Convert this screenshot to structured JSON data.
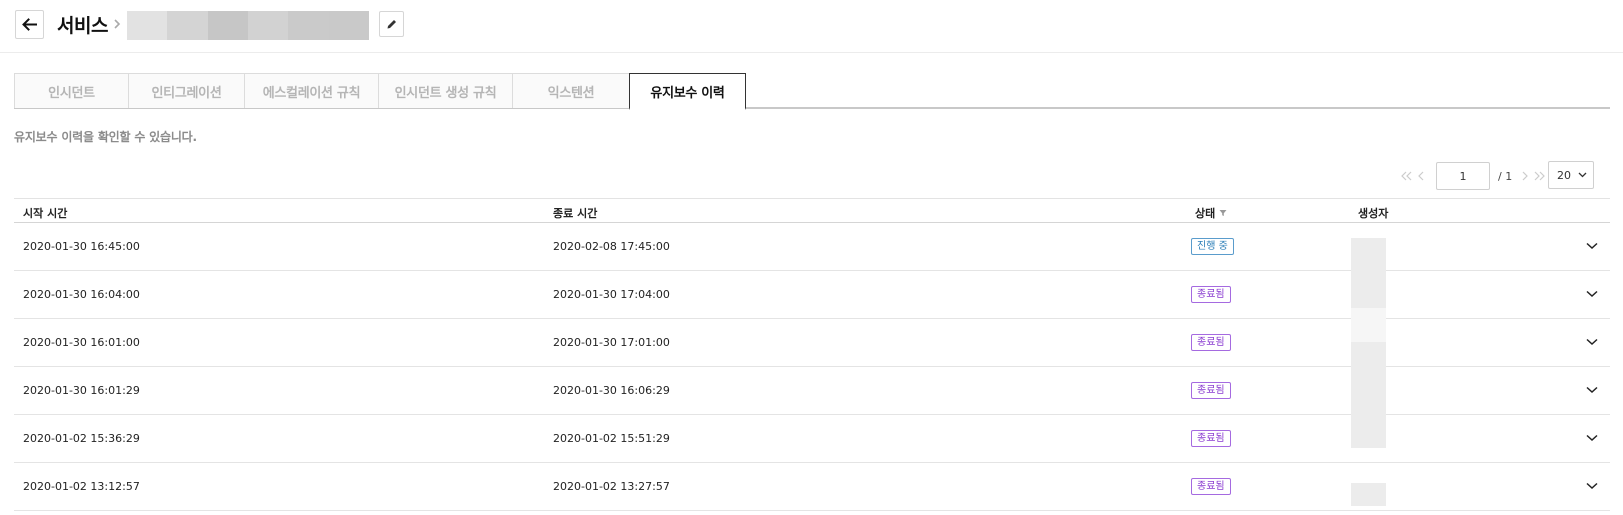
{
  "header": {
    "back_icon": "arrow-left-icon",
    "title": "서비스",
    "separator_icon": "chevron-right-icon",
    "edit_icon": "pencil-icon"
  },
  "tabs": [
    {
      "label": "인시던트",
      "active": false
    },
    {
      "label": "인티그레이션",
      "active": false
    },
    {
      "label": "에스컬레이션 규칙",
      "active": false
    },
    {
      "label": "인시던트 생성 규칙",
      "active": false
    },
    {
      "label": "익스텐션",
      "active": false
    },
    {
      "label": "유지보수 이력",
      "active": true
    }
  ],
  "description": "유지보수 이력을 확인할 수 있습니다.",
  "pagination": {
    "current_page": "1",
    "total": "/ 1",
    "page_size": "20"
  },
  "table": {
    "headers": {
      "start": "시작 시간",
      "end": "종료 시간",
      "status": "상태",
      "creator": "생성자"
    },
    "rows": [
      {
        "start": "2020-01-30 16:45:00",
        "end": "2020-02-08 17:45:00",
        "status": "진행 중"
      },
      {
        "start": "2020-01-30 16:04:00",
        "end": "2020-01-30 17:04:00",
        "status": "종료됨"
      },
      {
        "start": "2020-01-30 16:01:00",
        "end": "2020-01-30 17:01:00",
        "status": "종료됨"
      },
      {
        "start": "2020-01-30 16:01:29",
        "end": "2020-01-30 16:06:29",
        "status": "종료됨"
      },
      {
        "start": "2020-01-02 15:36:29",
        "end": "2020-01-02 15:51:29",
        "status": "종료됨"
      },
      {
        "start": "2020-01-02 13:12:57",
        "end": "2020-01-02 13:27:57",
        "status": "종료됨"
      }
    ]
  },
  "colors": {
    "status_ongoing": "#2d7fb8",
    "status_done": "#8a3bd0"
  }
}
